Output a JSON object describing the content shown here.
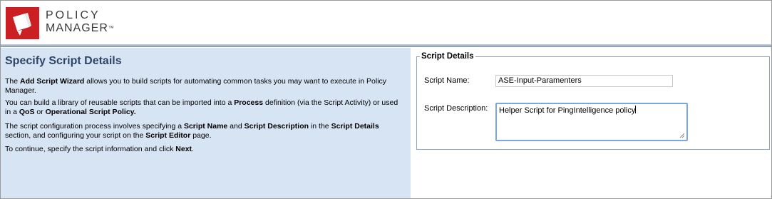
{
  "logo": {
    "line1": "POLICY",
    "line2": "MANAGER",
    "trademark": "™",
    "mark_color": "#cc1f24",
    "icon": "policy-manager-logo-icon"
  },
  "left_panel": {
    "title": "Specify Script Details",
    "p1": {
      "t1": "The ",
      "b1": "Add Script Wizard",
      "t2": " allows you to build scripts for automating common tasks you may want to execute in Policy Manager."
    },
    "p2": {
      "t1": "You can build a library of reusable scripts that can be imported into a ",
      "b1": "Process",
      "t2": " definition (via the Script Activity) or used in a ",
      "b2": "QoS",
      "t3": " or ",
      "b3": "Operational Script Policy."
    },
    "p3": {
      "t1": "The script configuration process involves specifying a ",
      "b1": "Script Name",
      "t2": " and ",
      "b2": "Script Description",
      "t3": " in the ",
      "b3": "Script Details",
      "t4": " section, and configuring your script on the ",
      "b4": "Script Editor",
      "t5": " page."
    },
    "p4": {
      "t1": "To continue, specify the script information and click ",
      "b1": "Next",
      "t2": "."
    }
  },
  "script_details": {
    "legend": "Script Details",
    "name_label": "Script Name:",
    "name_value": "ASE-Input-Paramenters",
    "description_label": "Script Description:",
    "description_value": "Helper Script for PingIntelligence policy"
  },
  "colors": {
    "left_panel_bg": "#d7e4f3",
    "title_color": "#2e4668",
    "focus_border": "#7ba7e0"
  }
}
